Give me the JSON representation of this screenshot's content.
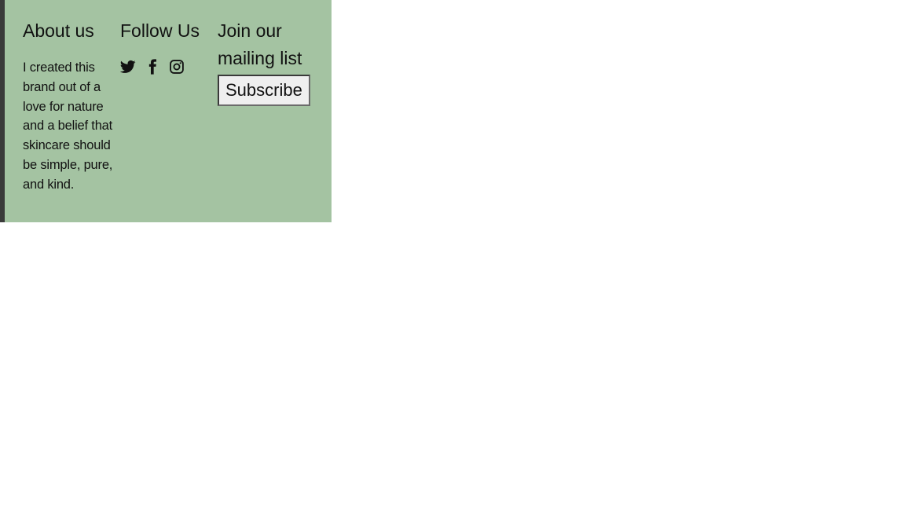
{
  "footer": {
    "about": {
      "heading": "About us",
      "text": "I created this brand out of a love for nature and a belief that skincare should be simple, pure, and kind."
    },
    "follow": {
      "heading": "Follow Us",
      "icons": [
        "twitter-icon",
        "facebook-icon",
        "instagram-icon"
      ]
    },
    "join": {
      "heading": "Join our mailing list",
      "button_label": "Subscribe"
    }
  },
  "colors": {
    "footer_background": "#a4c3a2",
    "left_border": "#3a3a3a",
    "text": "#111111"
  }
}
